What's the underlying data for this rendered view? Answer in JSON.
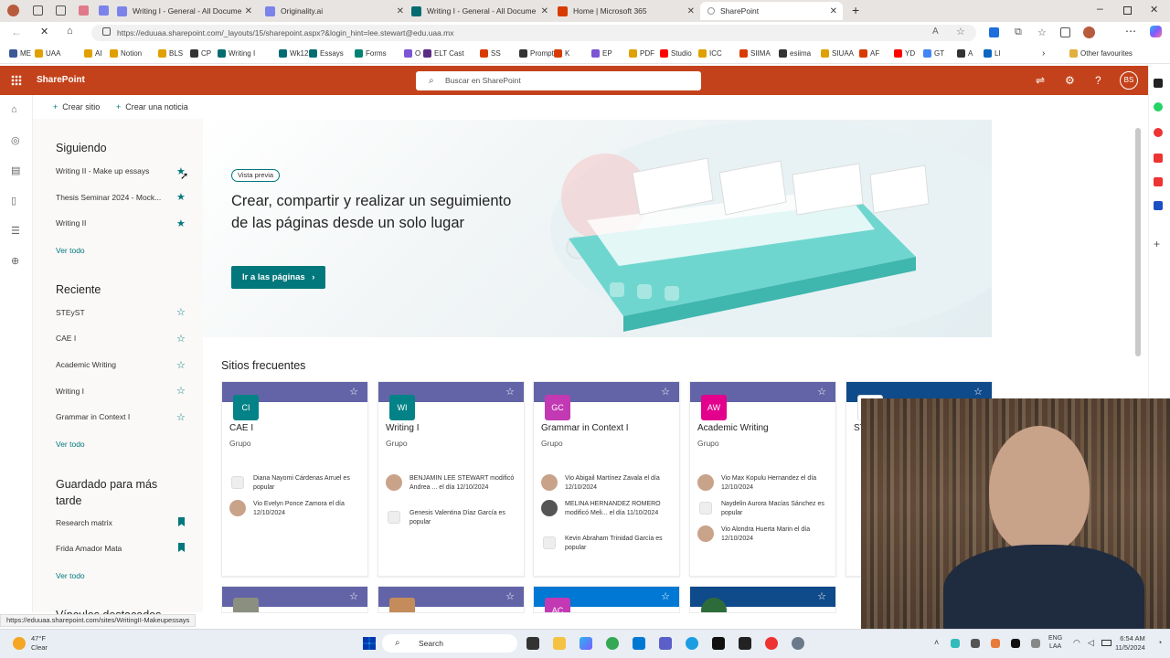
{
  "browser": {
    "tabs": [
      {
        "label": "Writing I - General - All Docume",
        "color": "#7b83eb"
      },
      {
        "label": "Originality.ai",
        "color": "#7b83eb"
      },
      {
        "label": "Writing I - General - All Docume",
        "color": "#036c70"
      },
      {
        "label": "Home | Microsoft 365",
        "color": "#d83b01"
      },
      {
        "label": "SharePoint",
        "color": "#036c70"
      }
    ],
    "url": "https://eduuaa.sharepoint.com/_layouts/15/sharepoint.aspx?&login_hint=lee.stewart@edu.uaa.mx",
    "bookmarks": [
      {
        "label": "ME",
        "color": "#3b5998"
      },
      {
        "label": "UAA",
        "color": "#e0a000"
      },
      {
        "label": "AI",
        "color": "#e0a000"
      },
      {
        "label": "Notion",
        "color": "#e0a000"
      },
      {
        "label": "BLS",
        "color": "#e0a000"
      },
      {
        "label": "CP",
        "color": "#333333"
      },
      {
        "label": "Writing I",
        "color": "#036c70"
      },
      {
        "label": "Wk12",
        "color": "#036c70"
      },
      {
        "label": "Essays",
        "color": "#036c70"
      },
      {
        "label": "Forms",
        "color": "#008272"
      },
      {
        "label": "O",
        "color": "#7b55d4"
      },
      {
        "label": "ELT Cast",
        "color": "#5b2c83"
      },
      {
        "label": "SS",
        "color": "#d83b01"
      },
      {
        "label": "Prompts",
        "color": "#333333"
      },
      {
        "label": "K",
        "color": "#d83b01"
      },
      {
        "label": "EP",
        "color": "#7b55d4"
      },
      {
        "label": "PDF",
        "color": "#e0a000"
      },
      {
        "label": "Studio",
        "color": "#ff0000"
      },
      {
        "label": "ICC",
        "color": "#e0a000"
      },
      {
        "label": "SIIMA",
        "color": "#d83b01"
      },
      {
        "label": "esiima",
        "color": "#333333"
      },
      {
        "label": "SIUAA",
        "color": "#e0a000"
      },
      {
        "label": "AF",
        "color": "#d83b01"
      },
      {
        "label": "YD",
        "color": "#ff0000"
      },
      {
        "label": "GT",
        "color": "#4285f4"
      },
      {
        "label": "A",
        "color": "#333333"
      },
      {
        "label": "LI",
        "color": "#0a66c2"
      }
    ],
    "other_favourites": "Other favourites",
    "status_url": "https://eduuaa.sharepoint.com/sites/WritingII-Makeupessays"
  },
  "sharepoint": {
    "app_name": "SharePoint",
    "search_placeholder": "Buscar en SharePoint",
    "user_initials": "BS",
    "brand_color": "#c4421b",
    "accent_color": "#03787c",
    "commands": {
      "create_site": "Crear sitio",
      "create_news": "Crear una noticia"
    },
    "following": {
      "heading": "Siguiendo",
      "items": [
        "Writing II - Make up essays",
        "Thesis Seminar 2024 - Mock...",
        "Writing II"
      ],
      "see_all": "Ver todo"
    },
    "recent": {
      "heading": "Reciente",
      "items": [
        "STEySТ",
        "CAE I",
        "Academic Writing",
        "Writing I",
        "Grammar in Context I"
      ],
      "see_all": "Ver todo"
    },
    "saved": {
      "heading": "Guardado para más tarde",
      "items": [
        "Research matrix",
        "Frida Amador Mata"
      ],
      "see_all": "Ver todo"
    },
    "featured_links_heading": "Vínculos destacados",
    "hero": {
      "badge": "Vista previa",
      "title": "Crear, compartir y realizar un seguimiento de las páginas desde un solo lugar",
      "button": "Ir a las páginas"
    },
    "frequent_sites": {
      "heading": "Sitios frecuentes",
      "cards": [
        {
          "initials": "CI",
          "name": "CAE I",
          "type": "Grupo",
          "band": "#6264a7",
          "avatar": "#038387",
          "activity": [
            {
              "icon": "page",
              "text": "Diana Nayomi Cárdenas Arruel es popular"
            },
            {
              "icon": "person",
              "text": "Vio Evelyn Ponce Zamora el día 12/10/2024"
            }
          ]
        },
        {
          "initials": "WI",
          "name": "Writing I",
          "type": "Grupo",
          "band": "#6264a7",
          "avatar": "#038387",
          "activity": [
            {
              "icon": "person",
              "text": "BENJAMIN LEE STEWART modificó Andrea ... el día 12/10/2024"
            },
            {
              "icon": "page",
              "text": "Genesis Valentina Díaz García es popular"
            }
          ]
        },
        {
          "initials": "GC",
          "name": "Grammar in Context I",
          "type": "Grupo",
          "band": "#6264a7",
          "avatar": "#c239b3",
          "activity": [
            {
              "icon": "person",
              "text": "Vio Abigail Martínez Zavala el día 12/10/2024"
            },
            {
              "icon": "person",
              "text": "MELINA HERNANDEZ ROMERO modificó Meli... el día 11/10/2024"
            },
            {
              "icon": "page",
              "text": "Kevin Abraham Trinidad García es popular"
            }
          ]
        },
        {
          "initials": "AW",
          "name": "Academic Writing",
          "type": "Grupo",
          "band": "#6264a7",
          "avatar": "#e3008c",
          "activity": [
            {
              "icon": "person",
              "text": "Vio Max Kopulu Hernandez el día 12/10/2024"
            },
            {
              "icon": "page",
              "text": "Naydelin Aurora Macías Sánchez es popular"
            },
            {
              "icon": "person",
              "text": "Vio Alondra Huerta Marin el día 12/10/2024"
            }
          ]
        },
        {
          "initials": "",
          "name": "ST",
          "type": "",
          "band": "#0f4a8a",
          "avatar": "#ffffff",
          "activity": []
        }
      ],
      "second_row": [
        {
          "initials": "",
          "band": "#6264a7",
          "avatar": "#8a8f80"
        },
        {
          "initials": "",
          "band": "#6264a7",
          "avatar": "#c48c5a"
        },
        {
          "initials": "AC",
          "band": "#0078d4",
          "avatar": "#c239b3"
        },
        {
          "initials": "",
          "band": "#0f4a8a",
          "avatar": "#2e6b3a"
        }
      ]
    }
  },
  "taskbar": {
    "temperature": "47°F",
    "condition": "Clear",
    "search": "Search",
    "lang_line1": "ENG",
    "lang_line2": "LAA",
    "time": "6:54 AM",
    "date": "11/5/2024"
  }
}
